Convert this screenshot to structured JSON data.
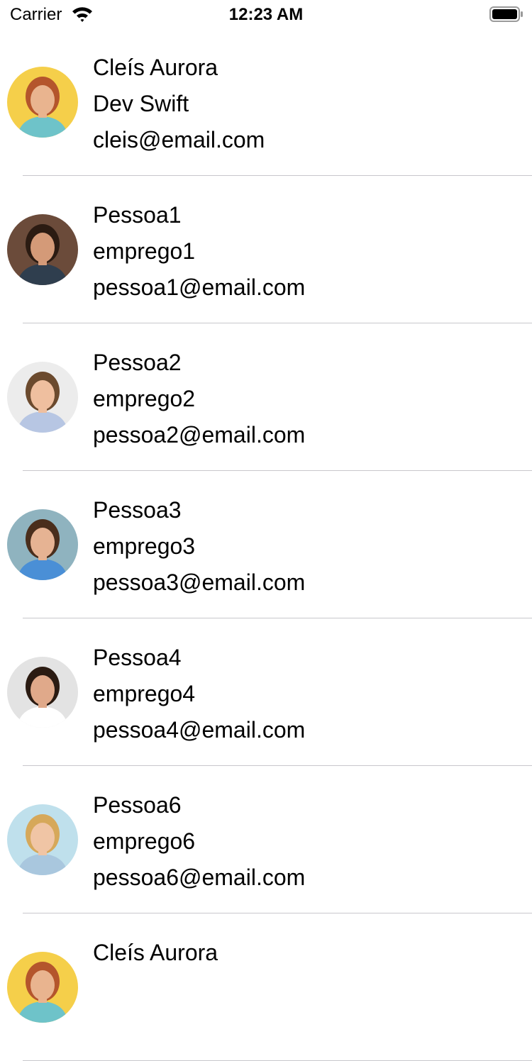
{
  "status_bar": {
    "carrier": "Carrier",
    "time": "12:23 AM",
    "wifi_icon": "wifi-icon",
    "battery_icon": "battery-icon"
  },
  "contacts": [
    {
      "name": "Cleís Aurora",
      "job": "Dev Swift",
      "email": "cleis@email.com",
      "avatar_bg": "#f5cf4a",
      "skin": "#e9b48f",
      "hair": "#b4552c",
      "shirt": "#6ec3c9"
    },
    {
      "name": "Pessoa1",
      "job": "emprego1",
      "email": "pessoa1@email.com",
      "avatar_bg": "#6b4b3a",
      "skin": "#d49a78",
      "hair": "#2b1b12",
      "shirt": "#2f3e4e"
    },
    {
      "name": "Pessoa2",
      "job": "emprego2",
      "email": "pessoa2@email.com",
      "avatar_bg": "#ececec",
      "skin": "#efbf9f",
      "hair": "#6b4a2e",
      "shirt": "#b7c6e3"
    },
    {
      "name": "Pessoa3",
      "job": "emprego3",
      "email": "pessoa3@email.com",
      "avatar_bg": "#8fb3bf",
      "skin": "#e6b393",
      "hair": "#4a2e1c",
      "shirt": "#4a8fd6"
    },
    {
      "name": "Pessoa4",
      "job": "emprego4",
      "email": "pessoa4@email.com",
      "avatar_bg": "#e3e3e3",
      "skin": "#e0a98a",
      "hair": "#2b1b12",
      "shirt": "#ffffff"
    },
    {
      "name": "Pessoa6",
      "job": "emprego6",
      "email": "pessoa6@email.com",
      "avatar_bg": "#bfe0ec",
      "skin": "#f0c5a5",
      "hair": "#d6a85a",
      "shirt": "#a9c7de"
    },
    {
      "name": "Cleís Aurora",
      "job": "",
      "email": "",
      "avatar_bg": "#f5cf4a",
      "skin": "#e9b48f",
      "hair": "#b4552c",
      "shirt": "#6ec3c9"
    }
  ]
}
